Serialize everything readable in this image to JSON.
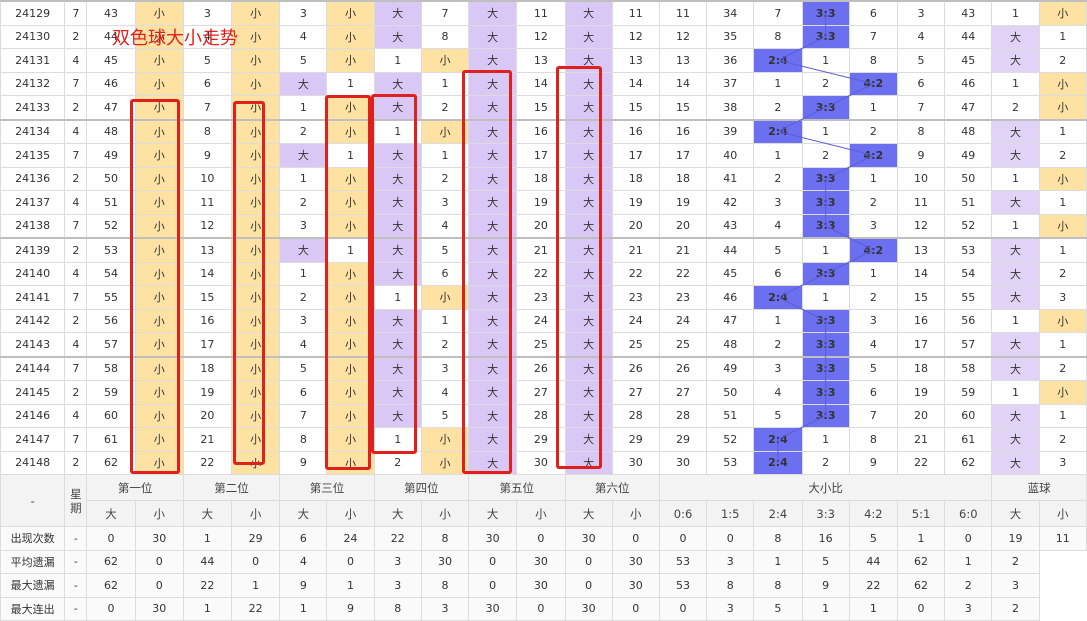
{
  "title": "双色球大小走势",
  "header": {
    "issue": "-",
    "week": "星期",
    "pos1": "第一位",
    "pos2": "第二位",
    "pos3": "第三位",
    "pos4": "第四位",
    "pos5": "第五位",
    "pos6": "第六位",
    "ratio": "大小比",
    "blue": "蓝球",
    "big": "大",
    "small": "小",
    "ratios": [
      "0:6",
      "1:5",
      "2:4",
      "3:3",
      "4:2",
      "5:1",
      "6:0"
    ]
  },
  "rows": [
    {
      "issue": "24129",
      "week": "7",
      "c": [
        "43",
        "小",
        "3",
        "小",
        "3",
        "小",
        "大",
        "7",
        "大",
        "11",
        "大",
        "11",
        "11",
        "34",
        "7",
        "3:3",
        "6",
        "3",
        "43",
        "1",
        "小"
      ]
    },
    {
      "issue": "24130",
      "week": "2",
      "c": [
        "44",
        "小",
        "4",
        "小",
        "4",
        "小",
        "大",
        "8",
        "大",
        "12",
        "大",
        "12",
        "12",
        "35",
        "8",
        "3:3",
        "7",
        "4",
        "44",
        "大",
        "1"
      ]
    },
    {
      "issue": "24131",
      "week": "4",
      "c": [
        "45",
        "小",
        "5",
        "小",
        "5",
        "小",
        "1",
        "小",
        "大",
        "13",
        "大",
        "13",
        "13",
        "36",
        "2:4",
        "1",
        "8",
        "5",
        "45",
        "大",
        "2"
      ]
    },
    {
      "issue": "24132",
      "week": "7",
      "c": [
        "46",
        "小",
        "6",
        "小",
        "大",
        "1",
        "大",
        "1",
        "大",
        "14",
        "大",
        "14",
        "14",
        "37",
        "1",
        "2",
        "4:2",
        "6",
        "46",
        "1",
        "小"
      ]
    },
    {
      "issue": "24133",
      "week": "2",
      "c": [
        "47",
        "小",
        "7",
        "小",
        "1",
        "小",
        "大",
        "2",
        "大",
        "15",
        "大",
        "15",
        "15",
        "38",
        "2",
        "3:3",
        "1",
        "7",
        "47",
        "2",
        "小"
      ]
    },
    {
      "issue": "24134",
      "week": "4",
      "c": [
        "48",
        "小",
        "8",
        "小",
        "2",
        "小",
        "1",
        "小",
        "大",
        "16",
        "大",
        "16",
        "16",
        "39",
        "2:4",
        "1",
        "2",
        "8",
        "48",
        "大",
        "1"
      ]
    },
    {
      "issue": "24135",
      "week": "7",
      "c": [
        "49",
        "小",
        "9",
        "小",
        "大",
        "1",
        "大",
        "1",
        "大",
        "17",
        "大",
        "17",
        "17",
        "40",
        "1",
        "2",
        "4:2",
        "9",
        "49",
        "大",
        "2"
      ]
    },
    {
      "issue": "24136",
      "week": "2",
      "c": [
        "50",
        "小",
        "10",
        "小",
        "1",
        "小",
        "大",
        "2",
        "大",
        "18",
        "大",
        "18",
        "18",
        "41",
        "2",
        "3:3",
        "1",
        "10",
        "50",
        "1",
        "小"
      ]
    },
    {
      "issue": "24137",
      "week": "4",
      "c": [
        "51",
        "小",
        "11",
        "小",
        "2",
        "小",
        "大",
        "3",
        "大",
        "19",
        "大",
        "19",
        "19",
        "42",
        "3",
        "3:3",
        "2",
        "11",
        "51",
        "大",
        "1"
      ]
    },
    {
      "issue": "24138",
      "week": "7",
      "c": [
        "52",
        "小",
        "12",
        "小",
        "3",
        "小",
        "大",
        "4",
        "大",
        "20",
        "大",
        "20",
        "20",
        "43",
        "4",
        "3:3",
        "3",
        "12",
        "52",
        "1",
        "小"
      ]
    },
    {
      "issue": "24139",
      "week": "2",
      "c": [
        "53",
        "小",
        "13",
        "小",
        "大",
        "1",
        "大",
        "5",
        "大",
        "21",
        "大",
        "21",
        "21",
        "44",
        "5",
        "1",
        "4:2",
        "13",
        "53",
        "大",
        "1"
      ]
    },
    {
      "issue": "24140",
      "week": "4",
      "c": [
        "54",
        "小",
        "14",
        "小",
        "1",
        "小",
        "大",
        "6",
        "大",
        "22",
        "大",
        "22",
        "22",
        "45",
        "6",
        "3:3",
        "1",
        "14",
        "54",
        "大",
        "2"
      ]
    },
    {
      "issue": "24141",
      "week": "7",
      "c": [
        "55",
        "小",
        "15",
        "小",
        "2",
        "小",
        "1",
        "小",
        "大",
        "23",
        "大",
        "23",
        "23",
        "46",
        "2:4",
        "1",
        "2",
        "15",
        "55",
        "大",
        "3"
      ]
    },
    {
      "issue": "24142",
      "week": "2",
      "c": [
        "56",
        "小",
        "16",
        "小",
        "3",
        "小",
        "大",
        "1",
        "大",
        "24",
        "大",
        "24",
        "24",
        "47",
        "1",
        "3:3",
        "3",
        "16",
        "56",
        "1",
        "小"
      ]
    },
    {
      "issue": "24143",
      "week": "4",
      "c": [
        "57",
        "小",
        "17",
        "小",
        "4",
        "小",
        "大",
        "2",
        "大",
        "25",
        "大",
        "25",
        "25",
        "48",
        "2",
        "3:3",
        "4",
        "17",
        "57",
        "大",
        "1"
      ]
    },
    {
      "issue": "24144",
      "week": "7",
      "c": [
        "58",
        "小",
        "18",
        "小",
        "5",
        "小",
        "大",
        "3",
        "大",
        "26",
        "大",
        "26",
        "26",
        "49",
        "3",
        "3:3",
        "5",
        "18",
        "58",
        "大",
        "2"
      ]
    },
    {
      "issue": "24145",
      "week": "2",
      "c": [
        "59",
        "小",
        "19",
        "小",
        "6",
        "小",
        "大",
        "4",
        "大",
        "27",
        "大",
        "27",
        "27",
        "50",
        "4",
        "3:3",
        "6",
        "19",
        "59",
        "1",
        "小"
      ]
    },
    {
      "issue": "24146",
      "week": "4",
      "c": [
        "60",
        "小",
        "20",
        "小",
        "7",
        "小",
        "大",
        "5",
        "大",
        "28",
        "大",
        "28",
        "28",
        "51",
        "5",
        "3:3",
        "7",
        "20",
        "60",
        "大",
        "1"
      ]
    },
    {
      "issue": "24147",
      "week": "7",
      "c": [
        "61",
        "小",
        "21",
        "小",
        "8",
        "小",
        "1",
        "小",
        "大",
        "29",
        "大",
        "29",
        "29",
        "52",
        "2:4",
        "1",
        "8",
        "21",
        "61",
        "大",
        "2"
      ]
    },
    {
      "issue": "24148",
      "week": "2",
      "c": [
        "62",
        "小",
        "22",
        "小",
        "9",
        "小",
        "2",
        "小",
        "大",
        "30",
        "大",
        "30",
        "30",
        "53",
        "2:4",
        "2",
        "9",
        "22",
        "62",
        "大",
        "3"
      ]
    }
  ],
  "stats": [
    {
      "label": "出现次数",
      "c": [
        "-",
        "0",
        "30",
        "1",
        "29",
        "6",
        "24",
        "22",
        "8",
        "30",
        "0",
        "30",
        "0",
        "0",
        "0",
        "8",
        "16",
        "5",
        "1",
        "0",
        "19",
        "11"
      ],
      "color": "red"
    },
    {
      "label": "平均遗漏",
      "c": [
        "-",
        "62",
        "0",
        "44",
        "0",
        "4",
        "0",
        "3",
        "30",
        "0",
        "30",
        "0",
        "30",
        "53",
        "3",
        "1",
        "5",
        "44",
        "62",
        "1",
        "2"
      ],
      "color": "red"
    },
    {
      "label": "最大遗漏",
      "c": [
        "-",
        "62",
        "0",
        "22",
        "1",
        "9",
        "1",
        "3",
        "8",
        "0",
        "30",
        "0",
        "30",
        "53",
        "8",
        "8",
        "9",
        "22",
        "62",
        "2",
        "3"
      ],
      "color": "blue"
    },
    {
      "label": "最大连出",
      "c": [
        "-",
        "0",
        "30",
        "1",
        "22",
        "1",
        "9",
        "8",
        "3",
        "30",
        "0",
        "30",
        "0",
        "0",
        "3",
        "5",
        "1",
        "1",
        "0",
        "3",
        "2"
      ],
      "color": "dark"
    }
  ]
}
